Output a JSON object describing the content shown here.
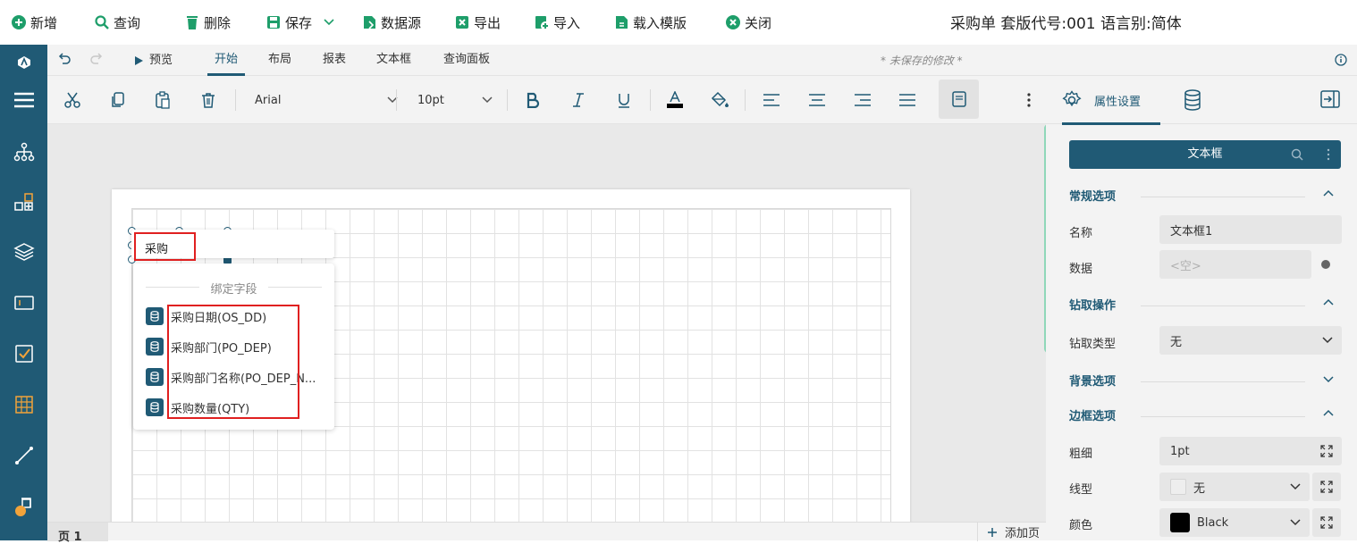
{
  "toolbar": {
    "new": "新增",
    "query": "查询",
    "delete": "删除",
    "save": "保存",
    "datasource": "数据源",
    "export": "导出",
    "import": "导入",
    "load_template": "载入模版",
    "close": "关闭"
  },
  "doc_title": "采购单 套版代号:001 语言别:简体",
  "menubar": {
    "preview": "预览",
    "tabs": [
      "开始",
      "布局",
      "报表",
      "文本框",
      "查询面板"
    ],
    "active_tab": "开始",
    "unsaved": "* 未保存的修改 *"
  },
  "format": {
    "font_family": "Arial",
    "font_size": "10pt"
  },
  "editor": {
    "textbox_value": "采购",
    "popup_title": "绑定字段",
    "fields": [
      "采购日期(OS_DD)",
      "采购部门(PO_DEP)",
      "采购部门名称(PO_DEP_N...",
      "采购数量(QTY)"
    ]
  },
  "bottom": {
    "page_tab": "页 1",
    "add_page": "添加页"
  },
  "panel": {
    "tab_label": "属性设置",
    "component": "文本框",
    "sections": {
      "general": "常规选项",
      "drill": "钻取操作",
      "background": "背景选项",
      "border": "边框选项"
    },
    "props": {
      "name_label": "名称",
      "name_value": "文本框1",
      "data_label": "数据",
      "data_placeholder": "<空>",
      "drill_type_label": "钻取类型",
      "drill_type_value": "无",
      "width_label": "粗细",
      "width_value": "1pt",
      "style_label": "线型",
      "style_value": "无",
      "color_label": "颜色",
      "color_value": "Black"
    }
  },
  "colors": {
    "primary": "#205a75",
    "accent_green": "#8fd7b9",
    "highlight_red": "#e02020"
  }
}
